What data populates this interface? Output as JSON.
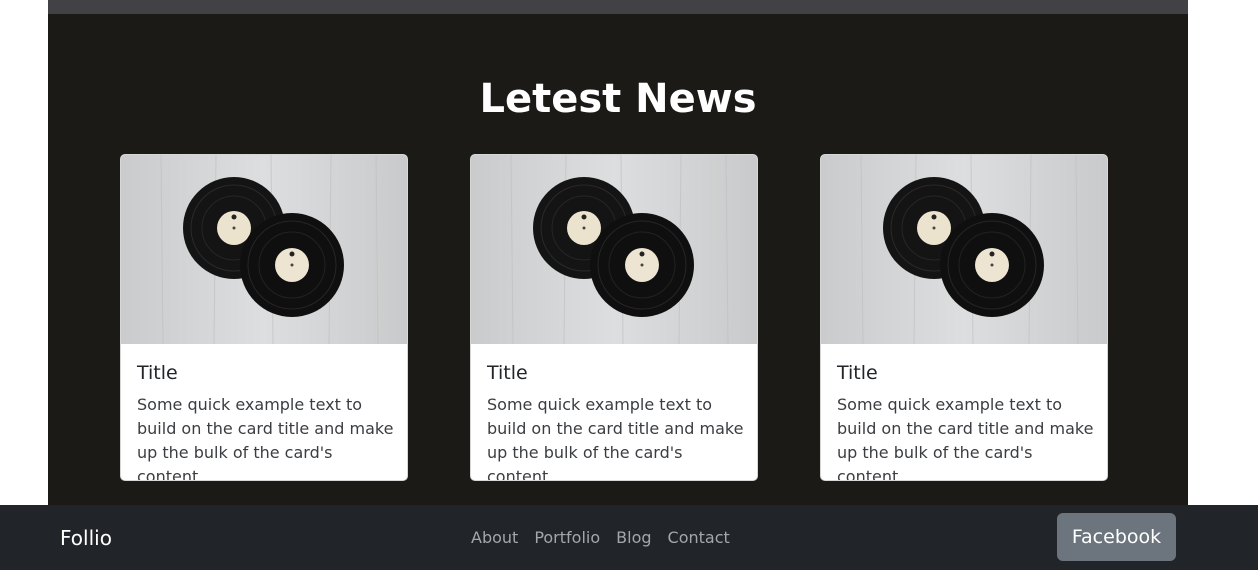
{
  "section": {
    "title": "Letest News"
  },
  "cards": [
    {
      "title": "Title",
      "text": "Some quick example text to build on the card title and make up the bulk of the card's content."
    },
    {
      "title": "Title",
      "text": "Some quick example text to build on the card title and make up the bulk of the card's content."
    },
    {
      "title": "Title",
      "text": "Some quick example text to build on the card title and make up the bulk of the card's content."
    }
  ],
  "footer": {
    "brand": "Follio",
    "nav": [
      "About",
      "Portfolio",
      "Blog",
      "Contact"
    ],
    "social_button": "Facebook"
  },
  "colors": {
    "section_bg": "#1c1a16",
    "footer_bg": "#212529",
    "button_bg": "#6c757d"
  }
}
